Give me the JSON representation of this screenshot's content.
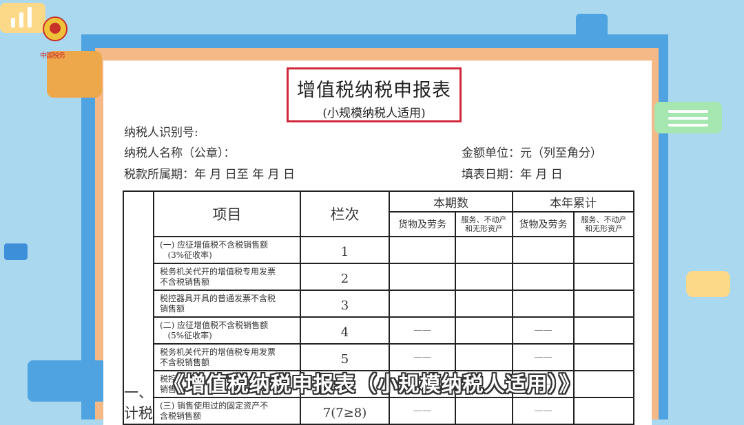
{
  "logo": {
    "org_text": "中国税务"
  },
  "form": {
    "title": "增值税纳税申报表",
    "subtitle": "(小规模纳税人适用)",
    "taxpayer_id_label": "纳税人识别号:",
    "taxpayer_name_label": "纳税人名称（公章）：",
    "amount_unit_label": "金额单位：元（列至角分）",
    "period_label": "税款所属期：年 月 日至 年 月 日",
    "fill_date_label": "填表日期：年 月 日"
  },
  "table": {
    "header": {
      "item": "项目",
      "line": "栏次",
      "current_period": "本期数",
      "year_to_date": "本年累计",
      "goods_services": "货物及劳务",
      "services_assets_line1": "服务、不动产",
      "services_assets_line2": "和无形资产"
    },
    "side_label": "一、计税",
    "rows": [
      {
        "item_line1": "(一) 应征增值税不含税销售额",
        "item_line2": "(3%征收率)",
        "line": "1",
        "dash": ""
      },
      {
        "item_line1": "税务机关代开的增值税专用发票",
        "item_line2": "不含税销售额",
        "line": "2",
        "dash": ""
      },
      {
        "item_line1": "税控器具开具的普通发票不含税",
        "item_line2": "销售额",
        "line": "3",
        "dash": ""
      },
      {
        "item_line1": "(二) 应征增值税不含税销售额",
        "item_line2": "(5%征收率)",
        "line": "4",
        "dash": "——"
      },
      {
        "item_line1": "税务机关代开的增值税专用发票",
        "item_line2": "不含税销售额",
        "line": "5",
        "dash": "——"
      },
      {
        "item_line1": "税控",
        "item_line2": "销售",
        "line": "6",
        "dash": "——"
      },
      {
        "item_line1": "(三) 销售使用过的固定资产不",
        "item_line2": "含税销售额",
        "line": "7(7≥8)",
        "dash": "——"
      }
    ]
  },
  "caption": "《增值税纳税申报表（小规模纳税人适用）》"
}
